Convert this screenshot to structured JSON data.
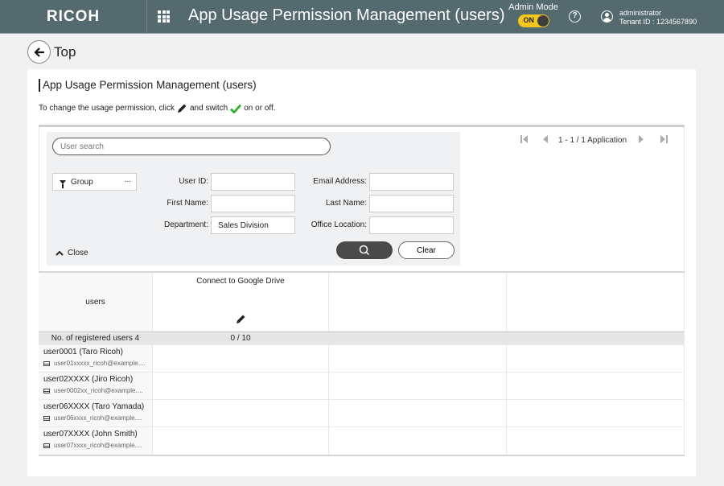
{
  "header": {
    "logo": "RICOH",
    "title": "App Usage Permission Management (users)",
    "admin_mode_label": "Admin Mode",
    "admin_toggle": "ON",
    "help_symbol": "?",
    "user_name": "administrator",
    "tenant_id": "Tenant ID : 1234567890",
    "icons": [
      "app-grid-icon",
      "help-icon",
      "user-account-icon"
    ]
  },
  "nav": {
    "back_label": "Top",
    "back_icon": "arrow-left-icon"
  },
  "page": {
    "title": "App Usage Permission Management (users)",
    "hint_prefix": "To change the usage permission, click",
    "hint_middle": "and switch",
    "hint_suffix": "on or off.",
    "accent_check_color": "#2bb32b"
  },
  "search": {
    "placeholder": "User search",
    "group_label": "Group",
    "group_more": "...",
    "fields": {
      "user_id_label": "User ID:",
      "user_id_value": "",
      "first_name_label": "First Name:",
      "first_name_value": "",
      "department_label": "Department:",
      "department_value": "Sales Division",
      "email_label": "Email Address:",
      "email_value": "",
      "last_name_label": "Last Name:",
      "last_name_value": "",
      "office_label": "Office Location:",
      "office_value": ""
    },
    "close_label": "Close",
    "clear_label": "Clear"
  },
  "pager": {
    "first": "⏮",
    "prev": "◀",
    "text": "1 - 1 / 1 Application",
    "next": "▶",
    "last": "⏭"
  },
  "table": {
    "users_header": "users",
    "app_columns": [
      "Connect to Google Drive",
      "",
      ""
    ],
    "registered_count_label": "No. of registered users 4",
    "app_usage_counts": [
      "0 / 10",
      "",
      ""
    ],
    "rows": [
      {
        "name": "user0001 (Taro Ricoh)",
        "email": "user01xxxxx_ricoh@example...."
      },
      {
        "name": "user02XXXX (Jiro Ricoh)",
        "email": "user0002xx_ricoh@example...."
      },
      {
        "name": "user06XXXX (Taro Yamada)",
        "email": "user06xxxx_ricoh@example...."
      },
      {
        "name": "user07XXXX (John Smith)",
        "email": "user07xxxx_ricoh@example...."
      }
    ]
  },
  "colors": {
    "header_bg": "#546a6f",
    "toggle_on": "#f4c71b",
    "search_button": "#4a4a4a"
  }
}
